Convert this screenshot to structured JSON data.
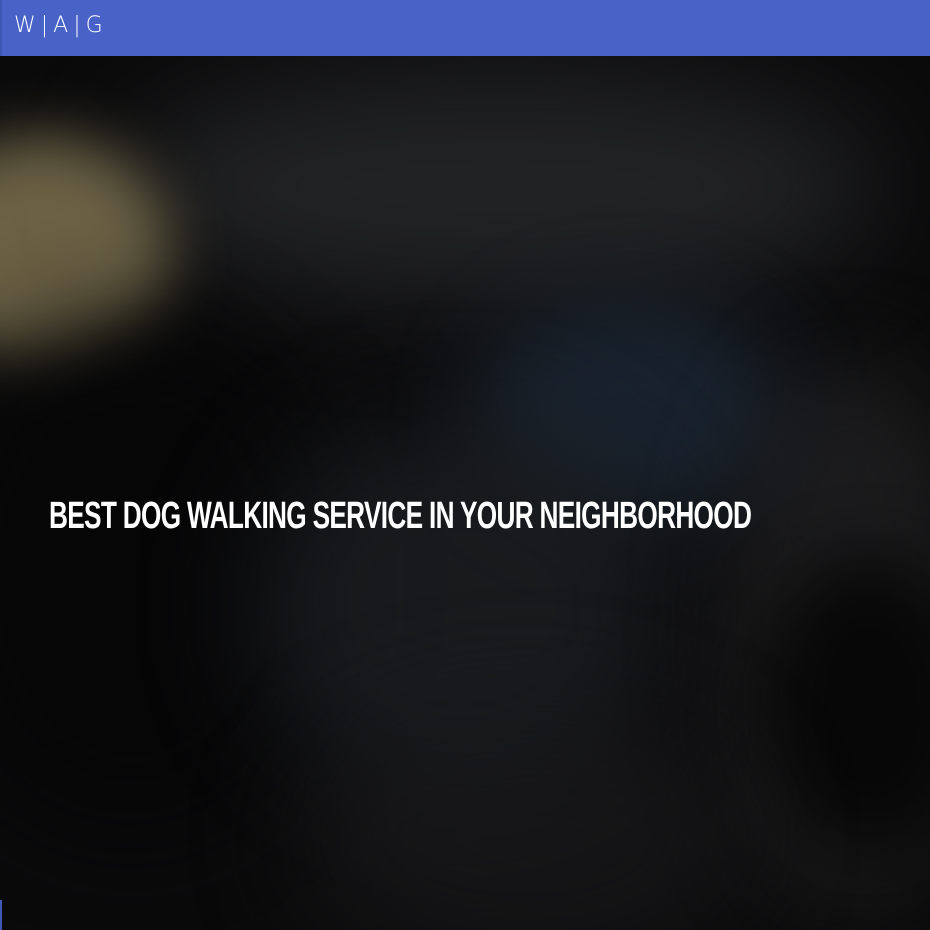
{
  "navbar": {
    "brand": "W|A|G",
    "color": "#4862c7"
  },
  "hero": {
    "headline": "BEST DOG WALKING SERVICE IN YOUR NEIGHBORHOOD",
    "background": "blurred-dog-photo"
  }
}
